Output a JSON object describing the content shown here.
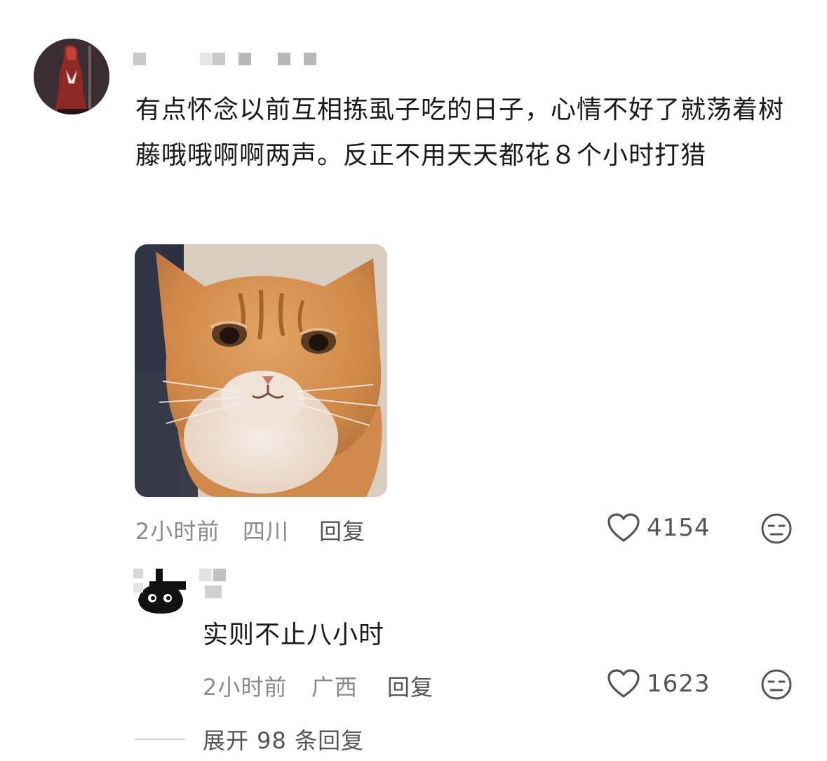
{
  "comment": {
    "text": "有点怀念以前互相拣虱子吃的日子，心情不好了就荡着树藤哦哦啊啊两声。反正不用天天都花８个小时打猎",
    "time": "2小时前",
    "location": "四川",
    "reply_label": "回复",
    "likes": "4154"
  },
  "reply": {
    "text": "实则不止八小时",
    "time": "2小时前",
    "location": "广西",
    "reply_label": "回复",
    "likes": "1623"
  },
  "expand": {
    "label": "展开 98 条回复"
  },
  "icons": {
    "like": "heart-icon",
    "dislike": "unamused-face-icon"
  }
}
